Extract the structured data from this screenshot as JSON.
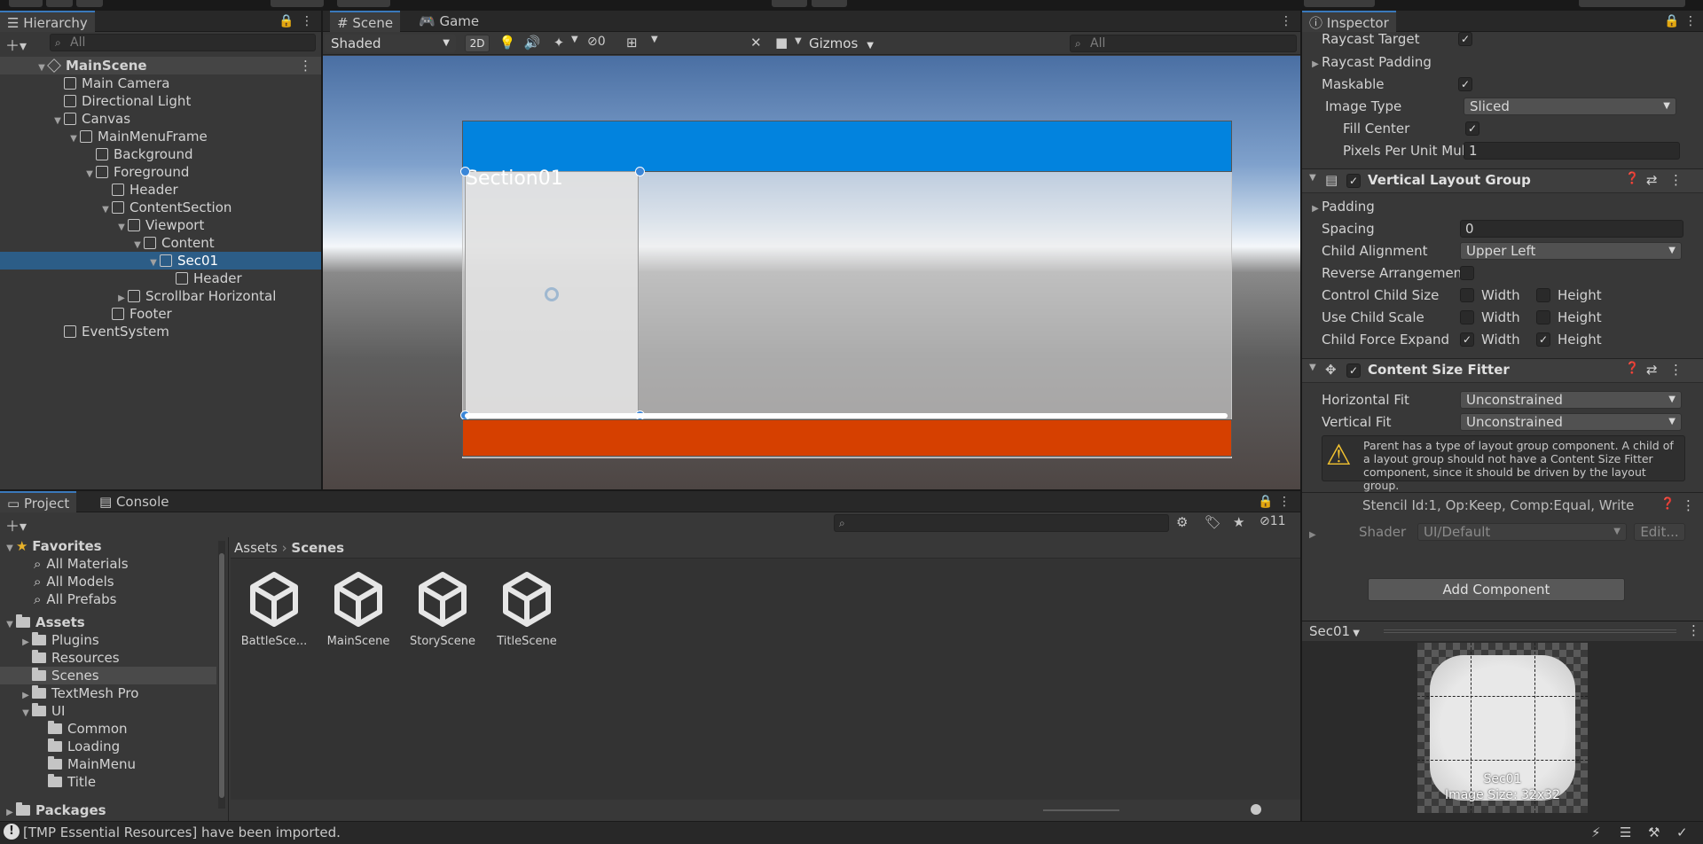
{
  "hierarchy": {
    "tab": "Hierarchy",
    "search_placeholder": "All",
    "items": [
      {
        "label": "MainScene",
        "depth": 0,
        "arrow": "▼",
        "bold": true
      },
      {
        "label": "Main Camera",
        "depth": 1,
        "arrow": ""
      },
      {
        "label": "Directional Light",
        "depth": 1,
        "arrow": ""
      },
      {
        "label": "Canvas",
        "depth": 1,
        "arrow": "▼"
      },
      {
        "label": "MainMenuFrame",
        "depth": 2,
        "arrow": "▼"
      },
      {
        "label": "Background",
        "depth": 3,
        "arrow": ""
      },
      {
        "label": "Foreground",
        "depth": 3,
        "arrow": "▼"
      },
      {
        "label": "Header",
        "depth": 4,
        "arrow": ""
      },
      {
        "label": "ContentSection",
        "depth": 4,
        "arrow": "▼"
      },
      {
        "label": "Viewport",
        "depth": 5,
        "arrow": "▼"
      },
      {
        "label": "Content",
        "depth": 6,
        "arrow": "▼"
      },
      {
        "label": "Sec01",
        "depth": 7,
        "arrow": "▼",
        "selected": true
      },
      {
        "label": "Header",
        "depth": 8,
        "arrow": ""
      },
      {
        "label": "Scrollbar Horizontal",
        "depth": 5,
        "arrow": "▶"
      },
      {
        "label": "Footer",
        "depth": 4,
        "arrow": ""
      },
      {
        "label": "EventSystem",
        "depth": 1,
        "arrow": ""
      }
    ]
  },
  "scene": {
    "tabs": [
      "Scene",
      "Game"
    ],
    "shading": "Shaded",
    "mode_2d": "2D",
    "hidden_count": "0",
    "gizmos": "Gizmos",
    "search_placeholder": "All",
    "section_label": "Section01",
    "colors": {
      "header": "#0283de",
      "footer": "#d64000"
    }
  },
  "project": {
    "tabs": [
      "Project",
      "Console"
    ],
    "badge_count": "11",
    "breadcrumb": [
      "Assets",
      "Scenes"
    ],
    "favorites_label": "Favorites",
    "favorites": [
      "All Materials",
      "All Models",
      "All Prefabs"
    ],
    "assets_label": "Assets",
    "tree": [
      {
        "label": "Plugins",
        "depth": 1,
        "arrow": "▶"
      },
      {
        "label": "Resources",
        "depth": 1,
        "arrow": ""
      },
      {
        "label": "Scenes",
        "depth": 1,
        "arrow": "",
        "selected": true
      },
      {
        "label": "TextMesh Pro",
        "depth": 1,
        "arrow": "▶"
      },
      {
        "label": "UI",
        "depth": 1,
        "arrow": "▼"
      },
      {
        "label": "Common",
        "depth": 2,
        "arrow": ""
      },
      {
        "label": "Loading",
        "depth": 2,
        "arrow": ""
      },
      {
        "label": "MainMenu",
        "depth": 2,
        "arrow": ""
      },
      {
        "label": "Title",
        "depth": 2,
        "arrow": ""
      }
    ],
    "packages_label": "Packages",
    "files": [
      "BattleSce...",
      "MainScene",
      "StoryScene",
      "TitleScene"
    ]
  },
  "inspector": {
    "tab": "Inspector",
    "raycast_target": "Raycast Target",
    "raycast_padding": "Raycast Padding",
    "maskable": "Maskable",
    "image_type": "Image Type",
    "image_type_value": "Sliced",
    "fill_center": "Fill Center",
    "pixels_per_unit": "Pixels Per Unit Mul",
    "pixels_per_unit_value": "1",
    "vlg": {
      "title": "Vertical Layout Group",
      "padding": "Padding",
      "spacing": "Spacing",
      "spacing_value": "0",
      "child_alignment": "Child Alignment",
      "child_alignment_value": "Upper Left",
      "reverse": "Reverse Arrangement",
      "control_child_size": "Control Child Size",
      "use_child_scale": "Use Child Scale",
      "child_force_expand": "Child Force Expand",
      "width": "Width",
      "height": "Height"
    },
    "csf": {
      "title": "Content Size Fitter",
      "horizontal_fit": "Horizontal Fit",
      "vertical_fit": "Vertical Fit",
      "horizontal_value": "Unconstrained",
      "vertical_value": "Unconstrained",
      "warning": "Parent has a type of layout group component. A child of a layout group should not have a Content Size Fitter component, since it should be driven by the layout group."
    },
    "material": {
      "stencil": "Stencil Id:1, Op:Keep, Comp:Equal, Write",
      "shader_label": "Shader",
      "shader_value": "UI/Default",
      "edit": "Edit..."
    },
    "add_component": "Add Component",
    "preview": {
      "object": "Sec01",
      "name": "Sec01",
      "size": "Image Size: 32x32"
    }
  },
  "status": {
    "message": "[TMP Essential Resources] have been imported."
  }
}
